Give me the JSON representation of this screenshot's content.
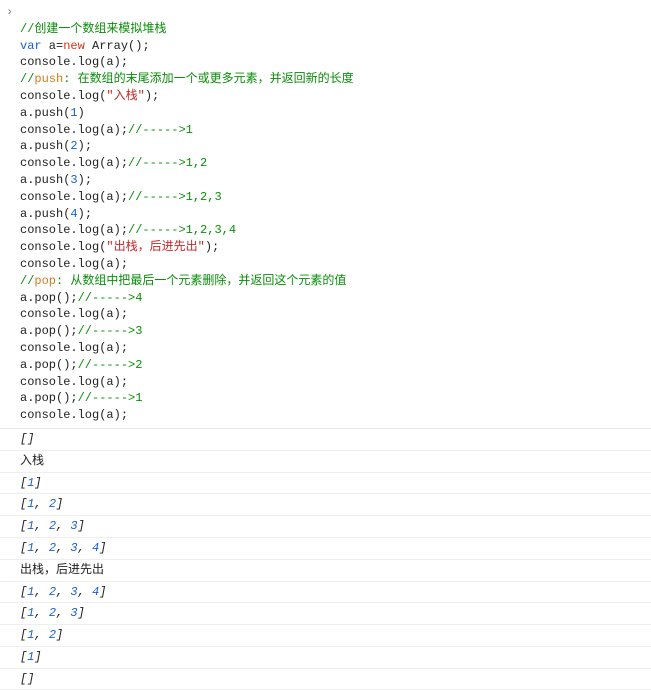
{
  "code": {
    "l01a": "//创建一个数组来模拟堆栈",
    "l02a": "var",
    "l02b": " a=",
    "l02c": "new",
    "l02d": " Array();",
    "l03": "console.log(a);",
    "l04a": "//",
    "l04b": "push",
    "l04c": ": 在数组的末尾添加一个或更多元素，并返回新的长度",
    "l05a": "console.log(",
    "l05b": "\"入栈\"",
    "l05c": ");",
    "l06a": "a.push(",
    "l06b": "1",
    "l06c": ")",
    "l07a": "console.log(a);",
    "l07b": "//----->1",
    "l08a": "a.push(",
    "l08b": "2",
    "l08c": ");",
    "l09a": "console.log(a);",
    "l09b": "//----->1,2",
    "l10a": "a.push(",
    "l10b": "3",
    "l10c": ");",
    "l11a": "console.log(a);",
    "l11b": "//----->1,2,3",
    "l12a": "a.push(",
    "l12b": "4",
    "l12c": ");",
    "l13a": "console.log(a);",
    "l13b": "//----->1,2,3,4",
    "l14a": "console.log(",
    "l14b": "\"出栈，后进先出\"",
    "l14c": ");",
    "l15": "console.log(a);",
    "l16a": "//",
    "l16b": "pop",
    "l16c": ": 从数组中把最后一个元素删除，并返回这个元素的值",
    "l17a": "a.pop();",
    "l17b": "//----->4",
    "l18": "console.log(a);",
    "l19a": "a.pop();",
    "l19b": "//----->3",
    "l20": "console.log(a);",
    "l21a": "a.pop();",
    "l21b": "//----->2",
    "l22": "console.log(a);",
    "l23a": "a.pop();",
    "l23b": "//----->1",
    "l24": "console.log(a);"
  },
  "out": {
    "caret": "›",
    "o1_l": "[",
    "o1_r": "]",
    "o2": "入栈",
    "o3_l": "[",
    "o3_v": "1",
    "o3_r": "]",
    "o4_l": "[",
    "o4_v1": "1",
    "o4_c1": ", ",
    "o4_v2": "2",
    "o4_r": "]",
    "o5_l": "[",
    "o5_v1": "1",
    "o5_c1": ", ",
    "o5_v2": "2",
    "o5_c2": ", ",
    "o5_v3": "3",
    "o5_r": "]",
    "o6_l": "[",
    "o6_v1": "1",
    "o6_c1": ", ",
    "o6_v2": "2",
    "o6_c2": ", ",
    "o6_v3": "3",
    "o6_c3": ", ",
    "o6_v4": "4",
    "o6_r": "]",
    "o7": "出栈，后进先出",
    "o8_l": "[",
    "o8_v1": "1",
    "o8_c1": ", ",
    "o8_v2": "2",
    "o8_c2": ", ",
    "o8_v3": "3",
    "o8_c3": ", ",
    "o8_v4": "4",
    "o8_r": "]",
    "o9_l": "[",
    "o9_v1": "1",
    "o9_c1": ", ",
    "o9_v2": "2",
    "o9_c2": ", ",
    "o9_v3": "3",
    "o9_r": "]",
    "o10_l": "[",
    "o10_v1": "1",
    "o10_c1": ", ",
    "o10_v2": "2",
    "o10_r": "]",
    "o11_l": "[",
    "o11_v": "1",
    "o11_r": "]",
    "o12_l": "[",
    "o12_r": "]"
  }
}
